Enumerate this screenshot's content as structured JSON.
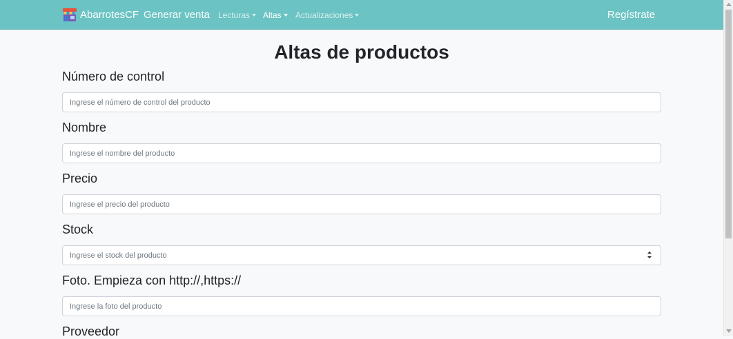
{
  "navbar": {
    "brand": "AbarrotesCF",
    "generar_venta": "Generar venta",
    "dropdowns": [
      {
        "label": "Lecturas"
      },
      {
        "label": "Altas"
      },
      {
        "label": "Actualizaciones"
      }
    ],
    "register": "Regístrate"
  },
  "page": {
    "title": "Altas de productos"
  },
  "form": {
    "fields": [
      {
        "label": "Número de control",
        "placeholder": "Ingrese el número de control del producto",
        "value": ""
      },
      {
        "label": "Nombre",
        "placeholder": "Ingrese el nombre del producto",
        "value": ""
      },
      {
        "label": "Precio",
        "placeholder": "Ingrese el precio del producto",
        "value": ""
      },
      {
        "label": "Stock",
        "placeholder": "Ingrese el stock del producto",
        "value": ""
      },
      {
        "label": "Foto. Empieza con http://,https://",
        "placeholder": "Ingrese la foto del producto",
        "value": ""
      },
      {
        "label": "Proveedor"
      }
    ]
  },
  "colors": {
    "navbar_bg": "#6bc3c3",
    "page_bg": "#f8f9fa"
  }
}
